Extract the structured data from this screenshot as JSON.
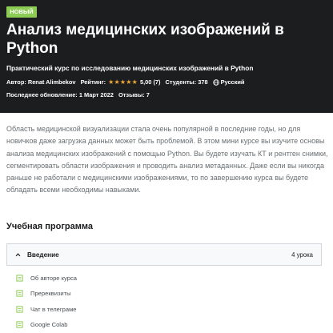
{
  "course": {
    "badge": "НОВЫЙ",
    "title": "Анализ медицинских изображений в Python",
    "subtitle": "Практический курс по исследованию медицинских изображений в Python",
    "author_label": "Автор:",
    "author": "Renat Alimbekov",
    "rating_label": "Рейтинг:",
    "rating_stars": "★★★★★",
    "rating_value": "5,00 (7)",
    "students": "Студенты: 378",
    "language": "Русский",
    "last_updated": "Последнее обновление: 1 Март 2022",
    "reviews": "Отзывы: 7"
  },
  "description": "Область медицинской визуализации стала очень популярной в последние годы, но для новичков даже загрузка данных может быть проблемой. В этом мини курсе вы изучите основы анализа медицинских изображений с помощью Python. Вы будете изучать КТ и рентген снимки, сегментировать области изображения и проводить анализ метаданных. Даже если вы никогда раньше не работали с медицинскими изображениями, то по завершению курса вы будете обладать всеми необходимы навыками.",
  "curriculum": {
    "title": "Учебная программа",
    "section": {
      "label": "Введение",
      "count": "4 урока"
    },
    "lessons": [
      "Об авторе курса",
      "Пререквизиты",
      "Чат в телеграме",
      "Google Colab"
    ]
  },
  "colors": {
    "hero_bg": "#1c1d1f",
    "badge_bg": "#8ccc54",
    "star": "#f3a736",
    "lesson_icon": "#8ccc54"
  },
  "icons": {
    "language": "globe-icon",
    "section_toggle": "chevron-up-icon",
    "lesson": "document-icon"
  }
}
